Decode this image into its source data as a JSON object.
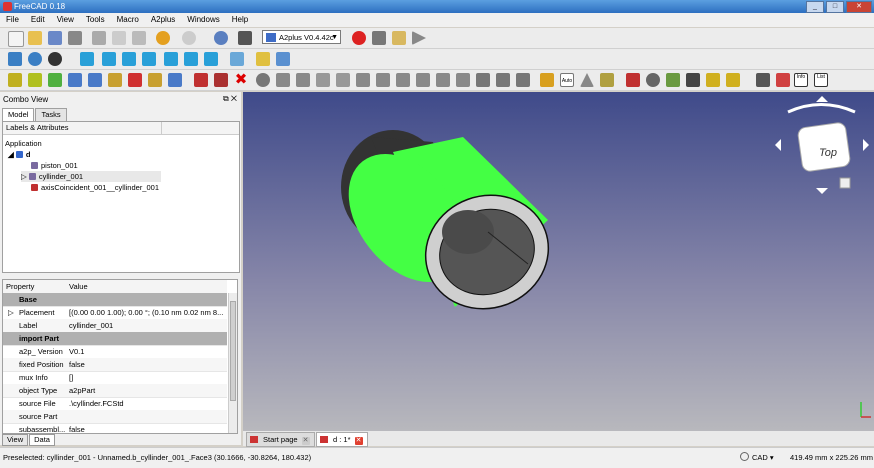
{
  "window": {
    "title": "FreeCAD 0.18"
  },
  "menu": [
    "File",
    "Edit",
    "View",
    "Tools",
    "Macro",
    "A2plus",
    "Windows",
    "Help"
  ],
  "toolbar": {
    "workbench": "A2plus V0.4.42c"
  },
  "combo": {
    "title": "Combo View",
    "tabs": [
      "Model",
      "Tasks"
    ],
    "tree_header": [
      "Labels & Attributes",
      ""
    ],
    "tree": {
      "root": "Application",
      "doc": "d",
      "items": [
        "piston_001",
        "cyllinder_001",
        "axisCoincident_001__cyllinder_001"
      ]
    }
  },
  "props": {
    "header": [
      "Property",
      "Value"
    ],
    "groups": {
      "base": "Base",
      "import": "import Part"
    },
    "rows": [
      {
        "k": "Placement",
        "v": "[(0.00 0.00 1.00); 0.00 °; (0.10 nm  0.02 nm  8..."
      },
      {
        "k": "Label",
        "v": "cyllinder_001"
      },
      {
        "k": "a2p_ Version",
        "v": "V0.1"
      },
      {
        "k": "fixed Position",
        "v": "false"
      },
      {
        "k": "mux Info",
        "v": "[]"
      },
      {
        "k": "object Type",
        "v": "a2pPart"
      },
      {
        "k": "source File",
        "v": ".\\cyllinder.FCStd"
      },
      {
        "k": "source Part",
        "v": ""
      },
      {
        "k": "subassembl...",
        "v": "false"
      }
    ]
  },
  "bottom_tabs": [
    "View",
    "Data"
  ],
  "nav_cube": {
    "face": "Top"
  },
  "doc_tabs": [
    "Start page",
    "d : 1*"
  ],
  "status": {
    "message": "Preselected: cyllinder_001 - Unnamed.b_cyllinder_001_.Face3 (30.1666, -30.8264, 180.432)",
    "nav": "CAD",
    "dims": "419.49 mm x 225.26 mm"
  },
  "colors": {
    "accent": "#44ff44",
    "title": "#3d7fd0"
  }
}
